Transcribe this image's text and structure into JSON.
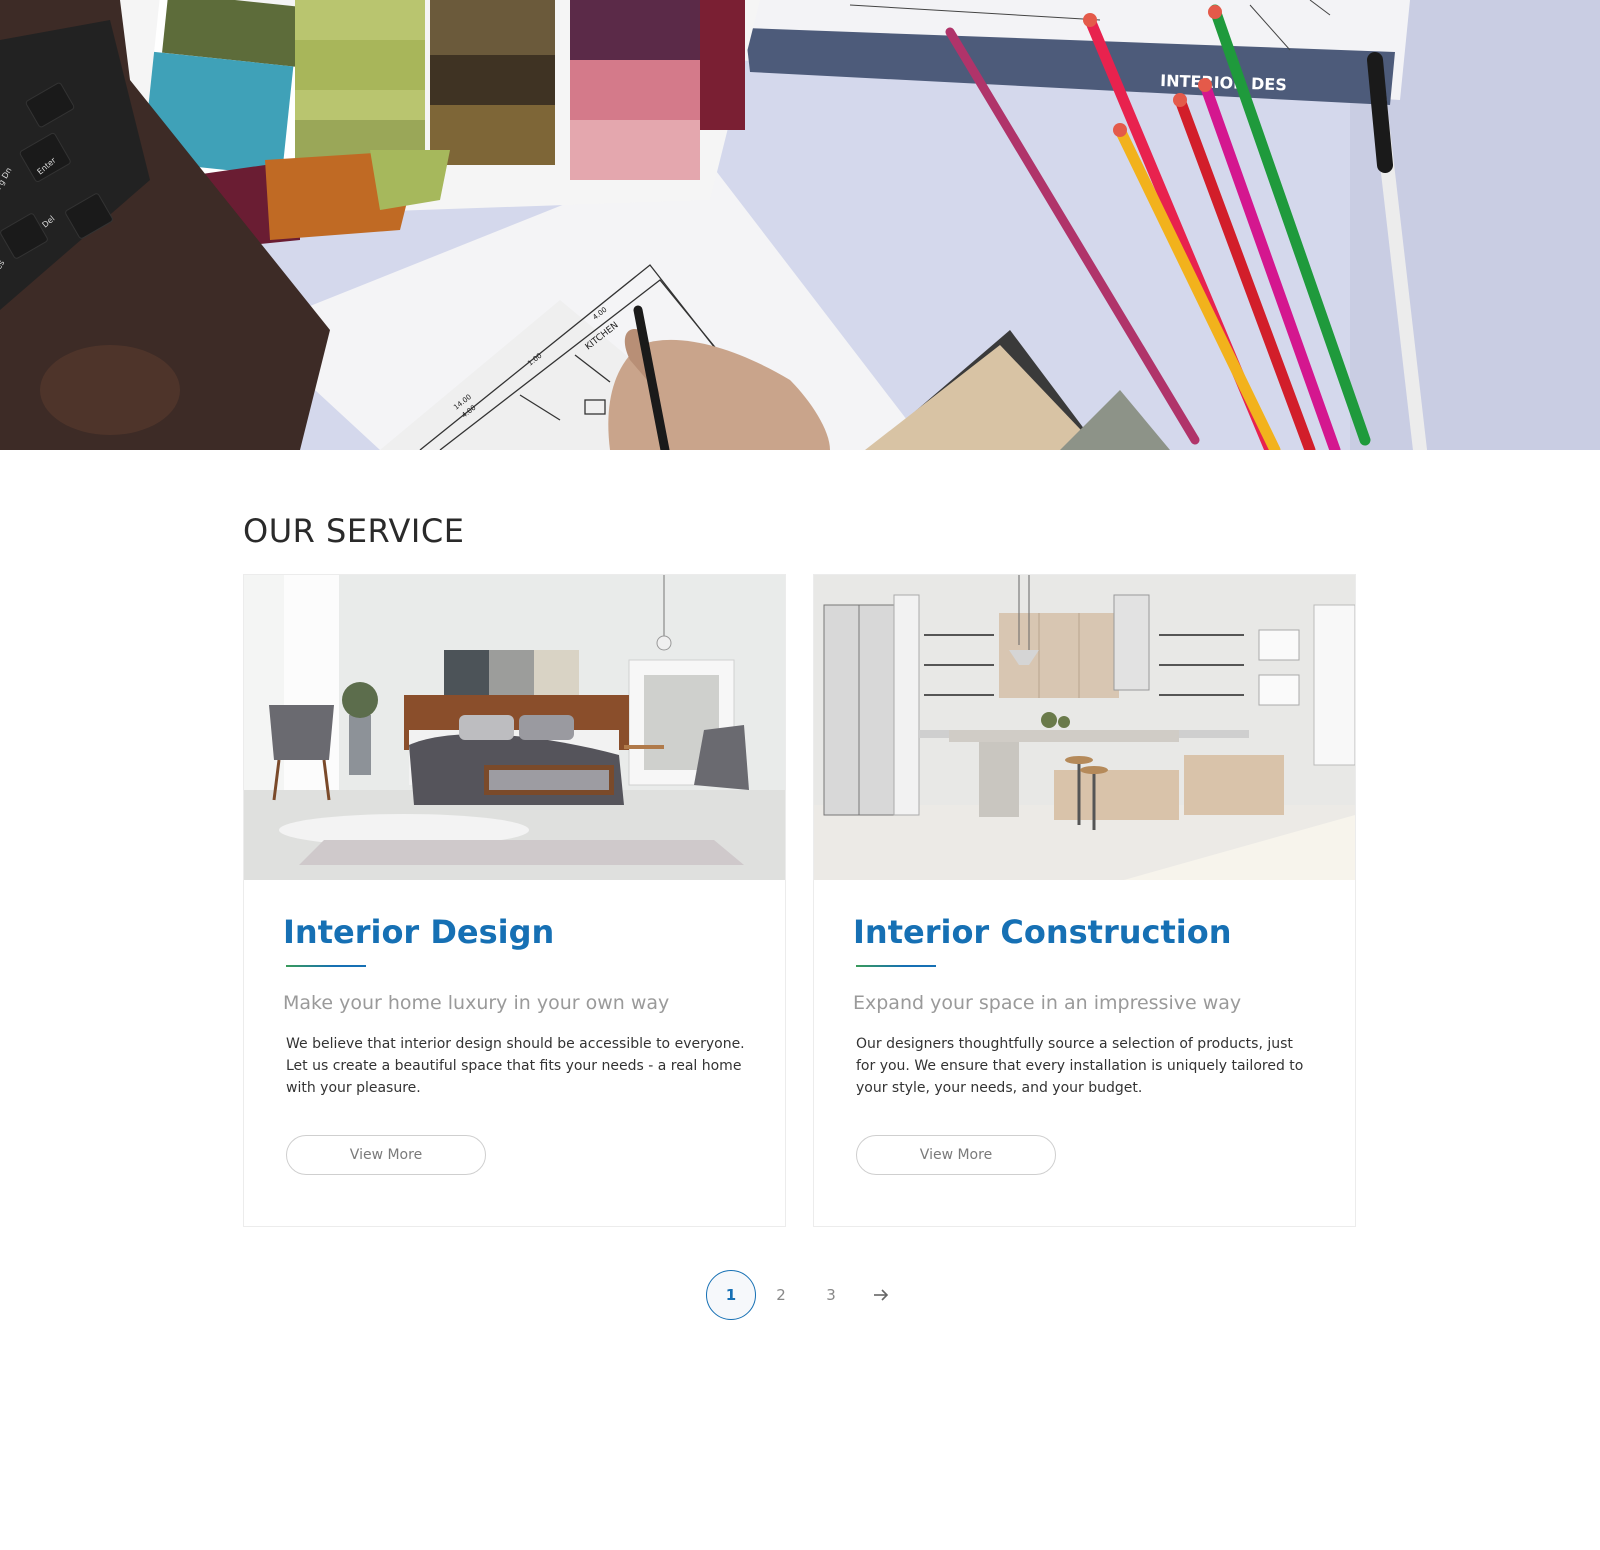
{
  "hero": {
    "banner_sign_text": "INTERIOR DES",
    "plan_label": "KITCHEN",
    "plan_dims": [
      "4.00",
      "1.00",
      "14.00",
      "4.00"
    ],
    "keyboard_keys": [
      "Enter",
      "Pg Dn",
      "Del",
      "es"
    ]
  },
  "section": {
    "title": "OUR SERVICE"
  },
  "cards": [
    {
      "title": "Interior Design",
      "subtitle": "Make your home luxury in your own way",
      "text": "We believe that interior design should be accessible to everyone. Let us create a beautiful space that fits your needs - a real home with your pleasure.",
      "button_label": "View More"
    },
    {
      "title": "Interior Construction",
      "subtitle": "Expand your space in an impressive way",
      "text": "Our designers thoughtfully source a selection of products, just for you. We ensure that every installation is uniquely tailored to your style, your needs, and your budget.",
      "button_label": "View More"
    }
  ],
  "pagination": {
    "pages": [
      "1",
      "2",
      "3"
    ],
    "current": "1",
    "next_icon": "arrow-right-icon"
  },
  "colors": {
    "accent": "#1670b4",
    "accent_green": "#3a9b5a",
    "title_text": "#2a2a2a",
    "muted_text": "#9a9a9a"
  }
}
